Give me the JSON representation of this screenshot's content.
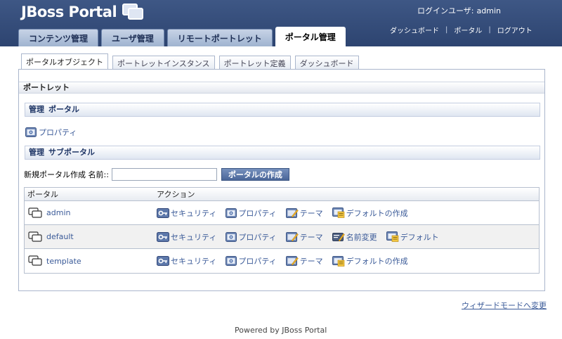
{
  "header": {
    "logo_text": "JBoss Portal",
    "login_label": "ログインユーザ:",
    "login_user": "admin",
    "links": [
      "ダッシュボード",
      "ポータル",
      "ログアウト"
    ],
    "link_separator": "|",
    "main_tabs": [
      "コンテンツ管理",
      "ユーザ管理",
      "リモートポートレット",
      "ポータル管理"
    ],
    "active_tab": "ポータル管理"
  },
  "sub_tabs": [
    "ポータルオブジェクト",
    "ポートレットインスタンス",
    "ポートレット定義",
    "ダッシュボード"
  ],
  "panel": {
    "portlet_title": "ポートレット",
    "section_portal": {
      "label1": "管理",
      "label2": "ポータル"
    },
    "properties_link": "プロパティ",
    "section_subportal": {
      "label1": "管理",
      "label2": "サブポータル"
    },
    "create_label": "新規ポータル作成 名前::",
    "create_input_value": "",
    "create_button": "ポータルの作成",
    "table": {
      "headers": [
        "ポータル",
        "アクション"
      ],
      "rows": [
        {
          "name": "admin",
          "actions": [
            {
              "icon": "security-key-icon",
              "label": "セキュリティ"
            },
            {
              "icon": "properties-icon",
              "label": "プロパティ"
            },
            {
              "icon": "theme-icon",
              "label": "テーマ"
            },
            {
              "icon": "make-default-icon",
              "label": "デフォルトの作成"
            }
          ]
        },
        {
          "name": "default",
          "actions": [
            {
              "icon": "security-key-icon",
              "label": "セキュリティ"
            },
            {
              "icon": "properties-icon",
              "label": "プロパティ"
            },
            {
              "icon": "theme-icon",
              "label": "テーマ"
            },
            {
              "icon": "rename-icon",
              "label": "名前変更"
            },
            {
              "icon": "default-icon",
              "label": "デフォルト"
            }
          ]
        },
        {
          "name": "template",
          "actions": [
            {
              "icon": "security-key-icon",
              "label": "セキュリティ"
            },
            {
              "icon": "properties-icon",
              "label": "プロパティ"
            },
            {
              "icon": "theme-icon",
              "label": "テーマ"
            },
            {
              "icon": "make-default-icon",
              "label": "デフォルトの作成"
            }
          ]
        }
      ]
    }
  },
  "wizard_link": "ウィザードモードへ変更",
  "footer": "Powered by JBoss Portal",
  "colors": {
    "header_bg": "#34497a",
    "link": "#3a5a98",
    "section_text": "#1f3666",
    "button_bg": "#4a6699"
  }
}
